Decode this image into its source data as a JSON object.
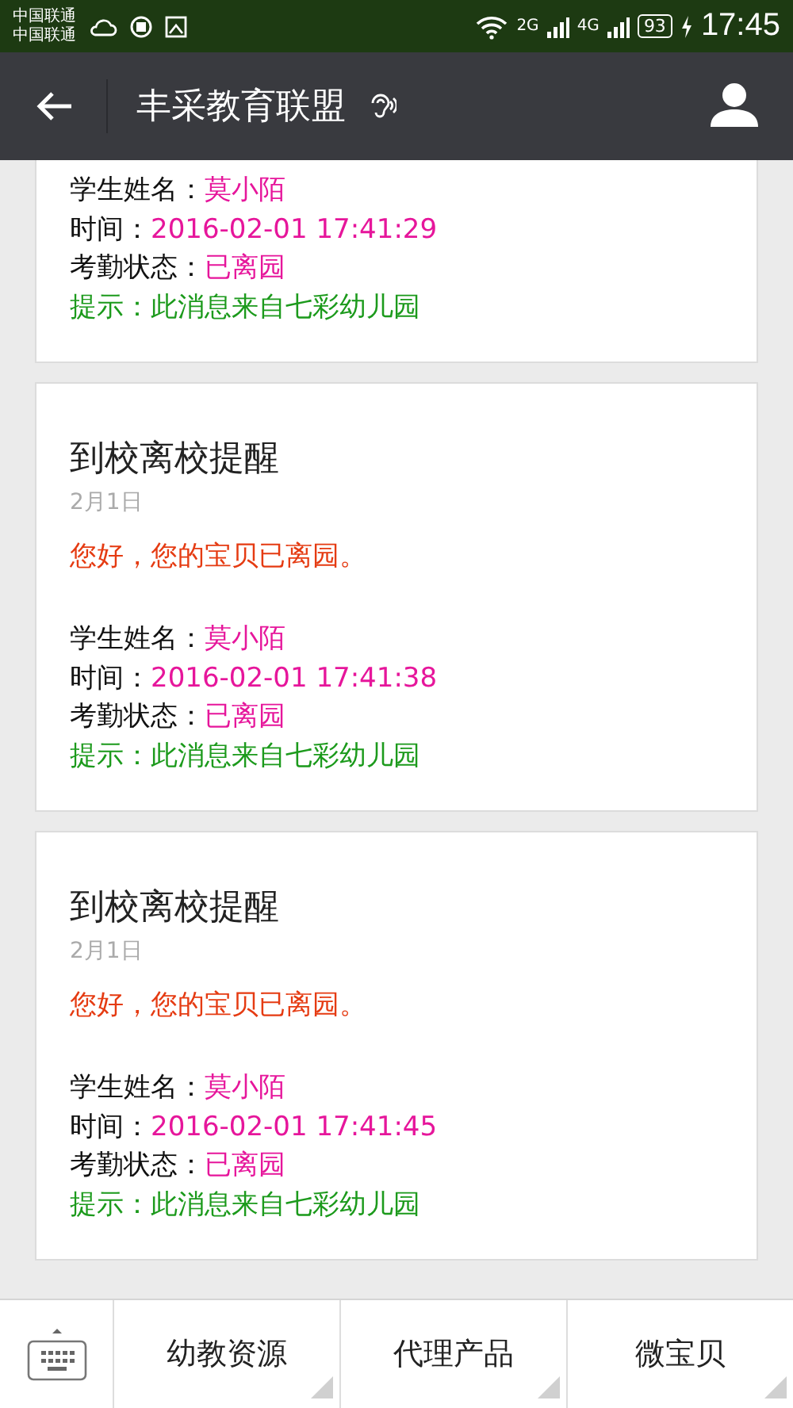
{
  "status_bar": {
    "carriers": [
      "中国联通",
      "中国联通"
    ],
    "network_labels": [
      "2G",
      "4G"
    ],
    "battery": "93",
    "time": "17:45"
  },
  "header": {
    "title": "丰采教育联盟"
  },
  "messages": [
    {
      "fields": [
        {
          "kind": "info",
          "label": "学生姓名：",
          "value": "莫小陌"
        },
        {
          "kind": "info",
          "label": "时间：",
          "value": "2016-02-01 17:41:29"
        },
        {
          "kind": "info",
          "label": "考勤状态：",
          "value": "已离园"
        },
        {
          "kind": "tip",
          "label": "提示：",
          "value": "此消息来自七彩幼儿园"
        }
      ]
    },
    {
      "title": "到校离校提醒",
      "date": "2月1日",
      "greeting": "您好，您的宝贝已离园。",
      "fields": [
        {
          "kind": "info",
          "label": "学生姓名：",
          "value": "莫小陌"
        },
        {
          "kind": "info",
          "label": "时间：",
          "value": "2016-02-01 17:41:38"
        },
        {
          "kind": "info",
          "label": "考勤状态：",
          "value": "已离园"
        },
        {
          "kind": "tip",
          "label": "提示：",
          "value": "此消息来自七彩幼儿园"
        }
      ]
    },
    {
      "title": "到校离校提醒",
      "date": "2月1日",
      "greeting": "您好，您的宝贝已离园。",
      "fields": [
        {
          "kind": "info",
          "label": "学生姓名：",
          "value": "莫小陌"
        },
        {
          "kind": "info",
          "label": "时间：",
          "value": "2016-02-01 17:41:45"
        },
        {
          "kind": "info",
          "label": "考勤状态：",
          "value": "已离园"
        },
        {
          "kind": "tip",
          "label": "提示：",
          "value": "此消息来自七彩幼儿园"
        }
      ]
    }
  ],
  "menu": [
    "幼教资源",
    "代理产品",
    "微宝贝"
  ]
}
